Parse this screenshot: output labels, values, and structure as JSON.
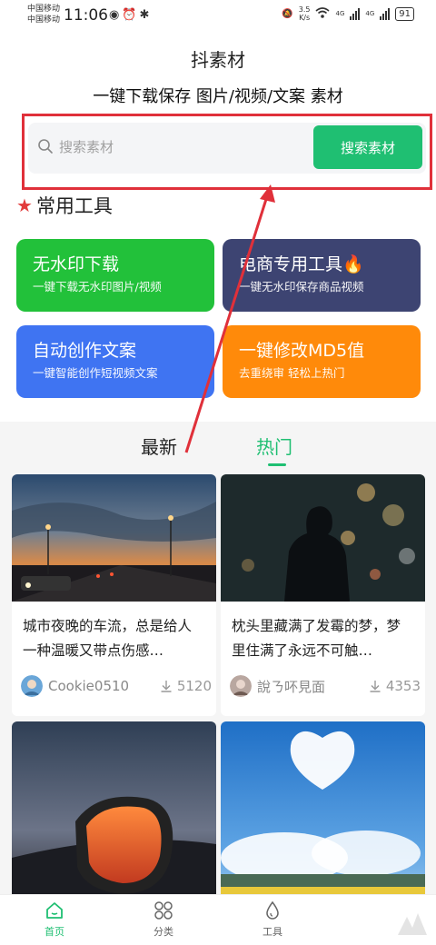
{
  "status_bar": {
    "carrier1": "中国移动",
    "carrier2": "中国移动",
    "time": "11:06",
    "speed_value": "3.5",
    "speed_unit": "K/s",
    "net1": "4G",
    "net2": "4G",
    "battery": "91"
  },
  "header": {
    "title": "抖素材",
    "tagline": "一键下载保存 图片/视频/文案 素材"
  },
  "search": {
    "placeholder": "搜索素材",
    "button_label": "搜索素材"
  },
  "tools_section": {
    "title": "常用工具",
    "tools": [
      {
        "title": "无水印下载",
        "subtitle": "一键下载无水印图片/视频",
        "color": "#22c13a"
      },
      {
        "title": "电商专用工具🔥",
        "subtitle": "一键无水印保存商品视频",
        "color": "#3d4472"
      },
      {
        "title": "自动创作文案",
        "subtitle": "一键智能创作短视频文案",
        "color": "#3f74f2"
      },
      {
        "title": "一键修改MD5值",
        "subtitle": "去重绕审 轻松上热门",
        "color": "#ff8a0a"
      }
    ]
  },
  "feed_tabs": {
    "latest": "最新",
    "hot": "热门",
    "active": "hot"
  },
  "posts": [
    {
      "title": "城市夜晚的车流，总是给人一种温暖又带点伤感…",
      "author": "Cookie0510",
      "downloads": "5120"
    },
    {
      "title": "枕头里藏满了发霉的梦，梦里住满了永远不可触…",
      "author": "說ㄋ吥見面",
      "downloads": "4353"
    },
    {
      "title": "",
      "author": "",
      "downloads": ""
    },
    {
      "title": "",
      "author": "",
      "downloads": ""
    }
  ],
  "bottom_nav": {
    "home": "首页",
    "category": "分类",
    "tools": "工具",
    "active": "home"
  },
  "colors": {
    "accent": "#1fbf72",
    "highlight_frame": "#e0303a"
  }
}
